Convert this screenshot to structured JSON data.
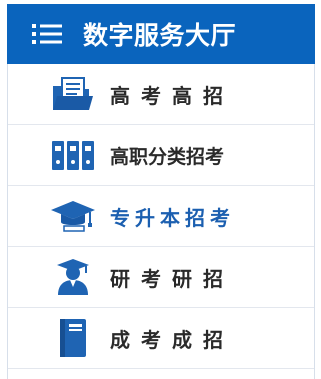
{
  "header": {
    "title": "数字服务大厅",
    "menu_icon": "hamburger-menu-icon",
    "background": "#0a64bd"
  },
  "menu": {
    "items": [
      {
        "label": "高考高招",
        "icon": "folder-document-icon",
        "active": false
      },
      {
        "label": "高职分类招考",
        "icon": "binders-icon",
        "active": false
      },
      {
        "label": "专升本招考",
        "icon": "graduation-cap-icon",
        "active": true
      },
      {
        "label": "研考研招",
        "icon": "graduate-student-icon",
        "active": false
      },
      {
        "label": "成考成招",
        "icon": "book-icon",
        "active": false
      }
    ]
  },
  "colors": {
    "brand": "#0a64bd",
    "active_text": "#1b5fb0",
    "text": "#2a2a2a",
    "icon": "#1f64b3"
  }
}
